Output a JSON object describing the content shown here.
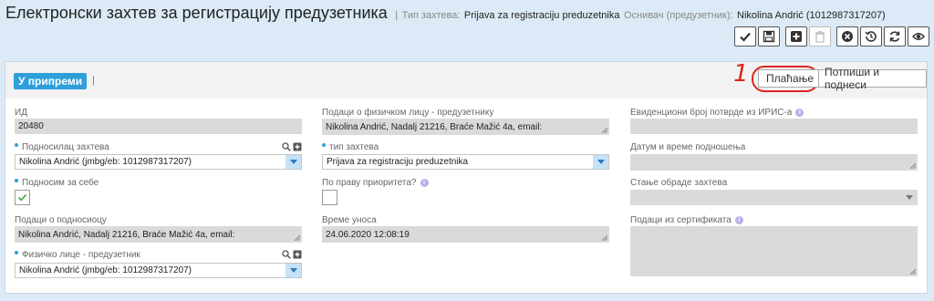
{
  "header": {
    "title": "Електронски захтев за регистрацију предузетника",
    "separator": "|",
    "type_label": "Тип захтева:",
    "type_value": "Prijava za registraciju preduzetnika",
    "founder_label": "Оснивач (предузетник):",
    "founder_value": "Nikolina Andrić (1012987317207)"
  },
  "toolbar": {
    "buttons": [
      {
        "icon": "check-icon"
      },
      {
        "icon": "save-icon"
      },
      {
        "icon": "plus-icon"
      },
      {
        "icon": "trash-icon",
        "disabled": true
      },
      {
        "icon": "cancel-icon"
      },
      {
        "icon": "history-icon"
      },
      {
        "icon": "refresh-icon"
      },
      {
        "icon": "eye-icon"
      }
    ]
  },
  "panel": {
    "status": "У припреми",
    "status_sep": "|",
    "pay_label": "Плаћање",
    "sign_label": "Потпиши и поднеси",
    "annotation_mark": "1"
  },
  "colors": {
    "accent": "#2e9fd9",
    "annotation": "#e0241f",
    "background": "#dbeaf6"
  },
  "form": {
    "id": {
      "label": "ИД",
      "value": "20480"
    },
    "submitter": {
      "label": "Подносилац захтева",
      "value": "Nikolina Andrić (jmbg/eb: 1012987317207)",
      "required": true
    },
    "submit_self": {
      "label": "Подносим за себе",
      "checked": true,
      "required": true
    },
    "submitter_data": {
      "label": "Подаци о подносиоцу",
      "value": "Nikolina Andrić, Nadalj 21216, Braće Mažić 4a, email:"
    },
    "entrepreneur": {
      "label": "Физичко лице - предузетник",
      "value": "Nikolina Andrić (jmbg/eb: 1012987317207)",
      "required": true
    },
    "person_data": {
      "label": "Подаци о физичком лицу - предузетнику",
      "value": "Nikolina Andrić, Nadalj 21216, Braće Mažić 4a, email:"
    },
    "request_type": {
      "label": "тип захтева",
      "value": "Prijava za registraciju preduzetnika",
      "required": true
    },
    "priority": {
      "label": "По праву приоритета?",
      "checked": false
    },
    "entry_time": {
      "label": "Време уноса",
      "value": "24.06.2020 12:08:19"
    },
    "iris_number": {
      "label": "Евиденциони број потврде из ИРИС-а",
      "value": ""
    },
    "submit_datetime": {
      "label": "Датум и време подношења",
      "value": ""
    },
    "processing_state": {
      "label": "Стање обраде захтева",
      "value": ""
    },
    "certificate_data": {
      "label": "Подаци из сертификата",
      "value": ""
    }
  }
}
